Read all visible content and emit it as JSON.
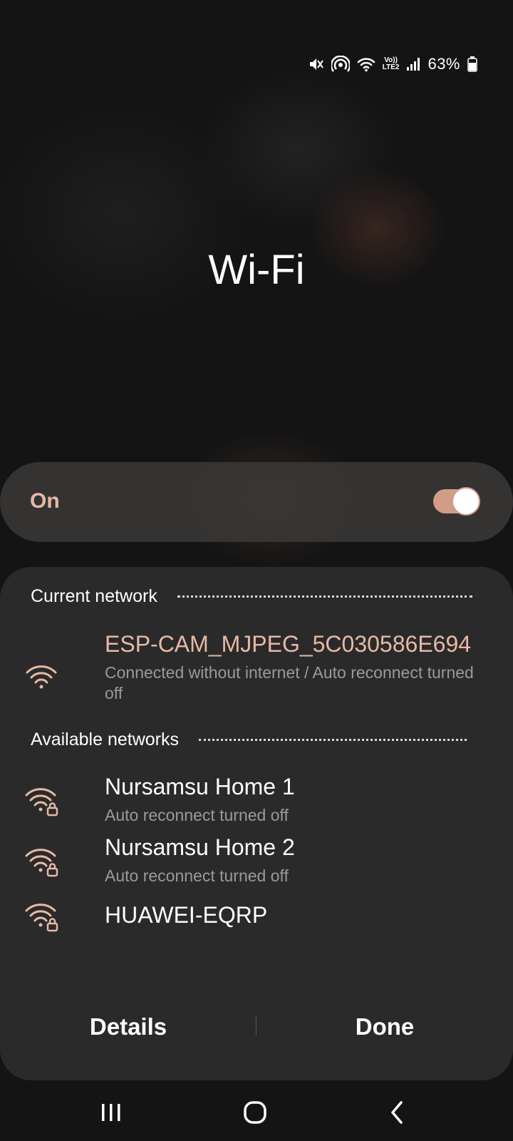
{
  "status_bar": {
    "icons": [
      "mute-icon",
      "hotspot-icon",
      "wifi-icon",
      "volte-icon",
      "signal-icon",
      "battery-icon"
    ],
    "volte_top": "Vo))",
    "volte_bottom": "LTE2",
    "battery_percent": "63%"
  },
  "title": "Wi-Fi",
  "toggle": {
    "label": "On",
    "state": true,
    "accent": "#d19d87"
  },
  "sections": {
    "current_header": "Current network",
    "available_header": "Available networks"
  },
  "current_network": {
    "name": "ESP-CAM_MJPEG_5C030586E694",
    "status": "Connected without internet / Auto reconnect turned off",
    "icon": "wifi-icon"
  },
  "available_networks": [
    {
      "name": "Nursamsu Home 1",
      "status": "Auto reconnect turned off",
      "icon": "wifi-lock-icon"
    },
    {
      "name": "Nursamsu Home 2",
      "status": "Auto reconnect turned off",
      "icon": "wifi-lock-icon"
    },
    {
      "name": "HUAWEI-EQRP",
      "status": "",
      "icon": "wifi-lock-icon"
    }
  ],
  "footer": {
    "details_label": "Details",
    "done_label": "Done"
  },
  "nav_bar": {
    "icons": [
      "recent-apps-icon",
      "home-icon",
      "back-icon"
    ]
  }
}
